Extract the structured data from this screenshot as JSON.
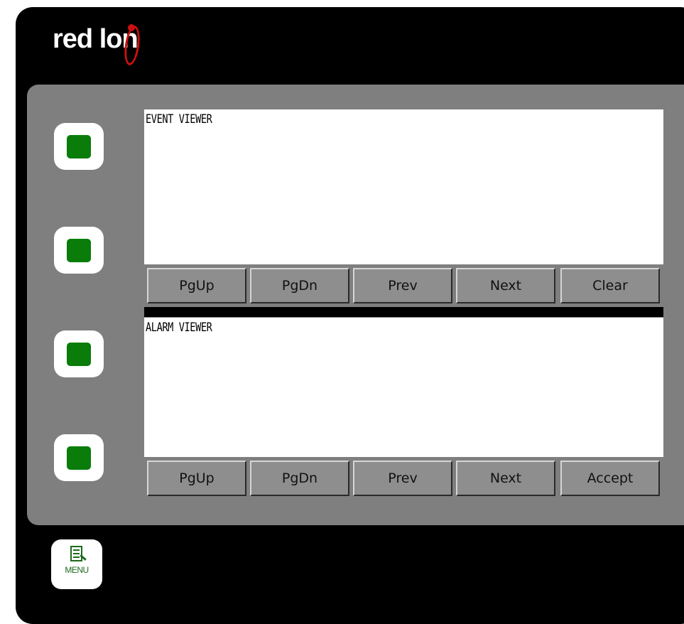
{
  "brand": {
    "logo_left": "red l",
    "logo_right": "on"
  },
  "softkeys": [
    {
      "name": "softkey-1"
    },
    {
      "name": "softkey-2"
    },
    {
      "name": "softkey-3"
    },
    {
      "name": "softkey-4"
    }
  ],
  "event_viewer": {
    "title": "EVENT VIEWER",
    "buttons": [
      "PgUp",
      "PgDn",
      "Prev",
      "Next",
      "Clear"
    ]
  },
  "alarm_viewer": {
    "title": "ALARM VIEWER",
    "buttons": [
      "PgUp",
      "PgDn",
      "Prev",
      "Next",
      "Accept"
    ]
  },
  "menu": {
    "label": "MENU",
    "icon": "document-list-icon"
  },
  "colors": {
    "led_green": "#0a7c0a",
    "bezel_gray": "#7f7f7f",
    "brand_red": "#cc1010"
  }
}
